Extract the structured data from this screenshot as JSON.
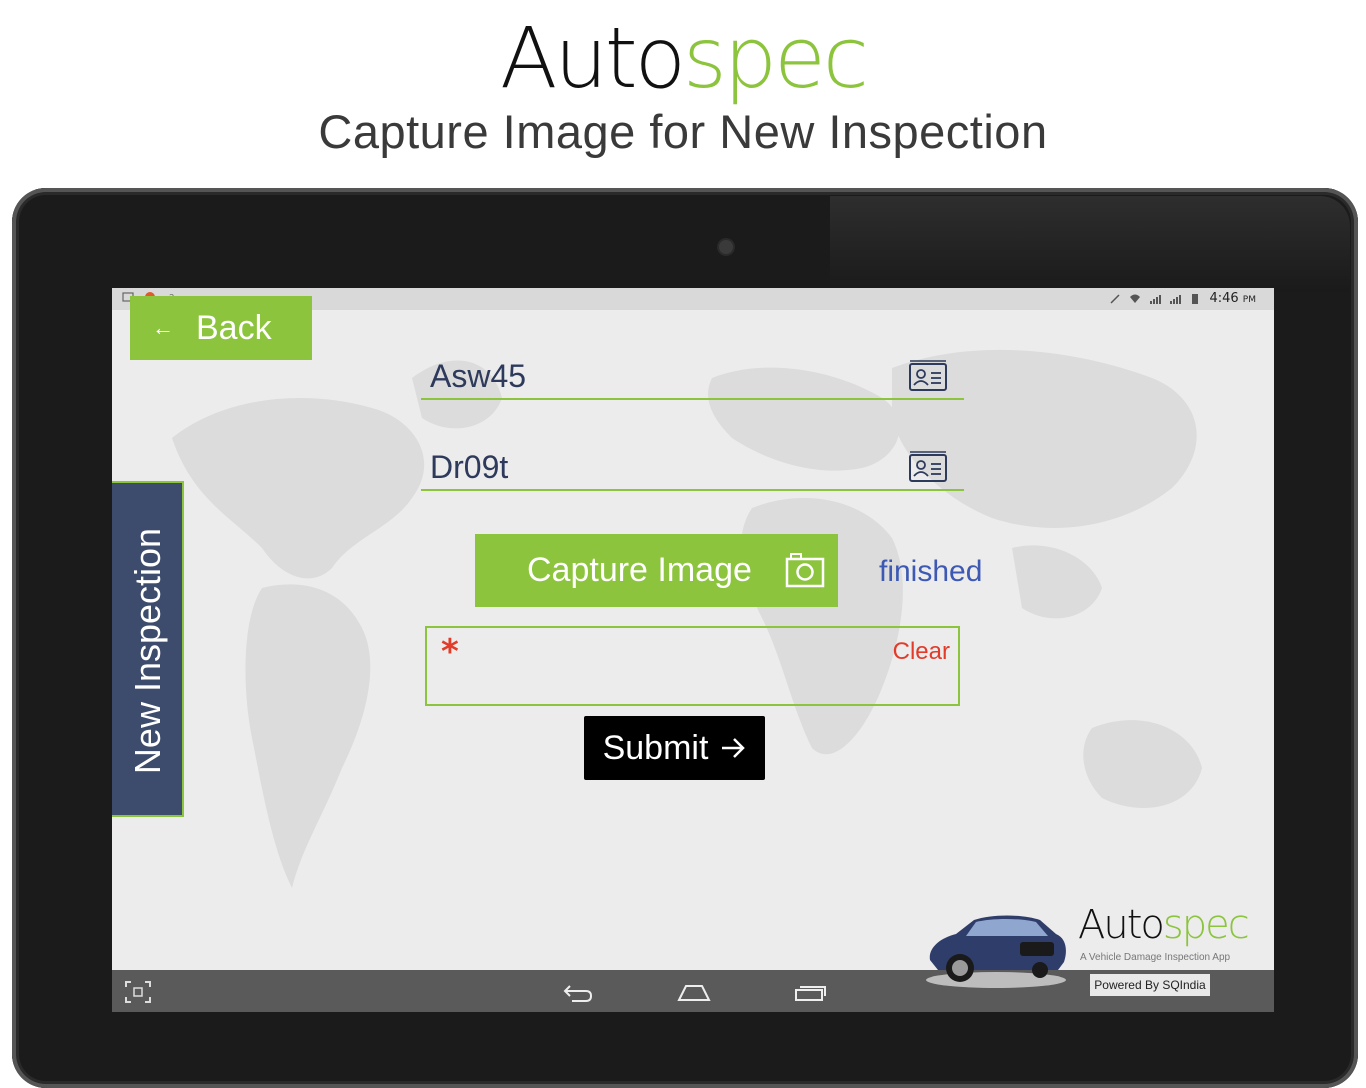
{
  "promo": {
    "logo_auto": "Auto",
    "logo_spec": "spec",
    "subtitle": "Capture Image for New Inspection"
  },
  "statusbar": {
    "time": "4:46",
    "ampm": "PM"
  },
  "back_button": {
    "label": "Back"
  },
  "side_tab": {
    "label": "New Inspection"
  },
  "fields": [
    {
      "value": "Asw45",
      "icon": "id-card-icon"
    },
    {
      "value": "Dr09t",
      "icon": "id-card-icon"
    }
  ],
  "capture_button": {
    "label": "Capture Image",
    "icon": "camera-icon"
  },
  "capture_status": "finished",
  "signature_box": {
    "required_mark": "*",
    "clear_label": "Clear"
  },
  "submit_button": {
    "label": "Submit",
    "icon": "arrow-right-icon"
  },
  "brand": {
    "logo_auto": "Auto",
    "logo_spec": "spec",
    "tagline": "A Vehicle Damage Inspection App",
    "powered": "Powered By SQIndia"
  },
  "colors": {
    "accent_green": "#8cc43d",
    "navy": "#3d4b6d",
    "link_blue": "#3d59b3",
    "error_red": "#e23b2a"
  }
}
